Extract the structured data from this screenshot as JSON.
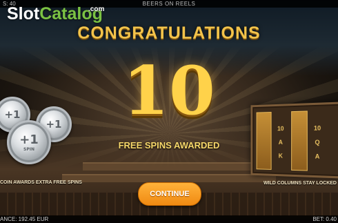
{
  "top_bar": {
    "left_text": "S: 40",
    "title": "BEERS ON REELS"
  },
  "watermark": {
    "slot": "Slot",
    "catalog": "Catalog",
    "com": ".com"
  },
  "popup": {
    "heading": "CONGRATULATIONS",
    "free_spins_count": "10",
    "free_spins_label": "FREE SPINS AWARDED",
    "coin_caption": "COIN AWARDS EXTRA FREE SPINS",
    "wild_caption": "WILD COLUMNS STAY LOCKED",
    "continue_label": "CONTINUE"
  },
  "coins": [
    {
      "text": "+1"
    },
    {
      "text": "+1"
    },
    {
      "text": "+1"
    }
  ],
  "coin_spin_text": "SPIN",
  "bottom_bar": {
    "balance": "ANCE: 192.45 EUR",
    "bet": "BET: 0.40"
  },
  "colors": {
    "gold": "#f3c34a",
    "button": "#f08a12",
    "logo_green": "#7bc243"
  }
}
